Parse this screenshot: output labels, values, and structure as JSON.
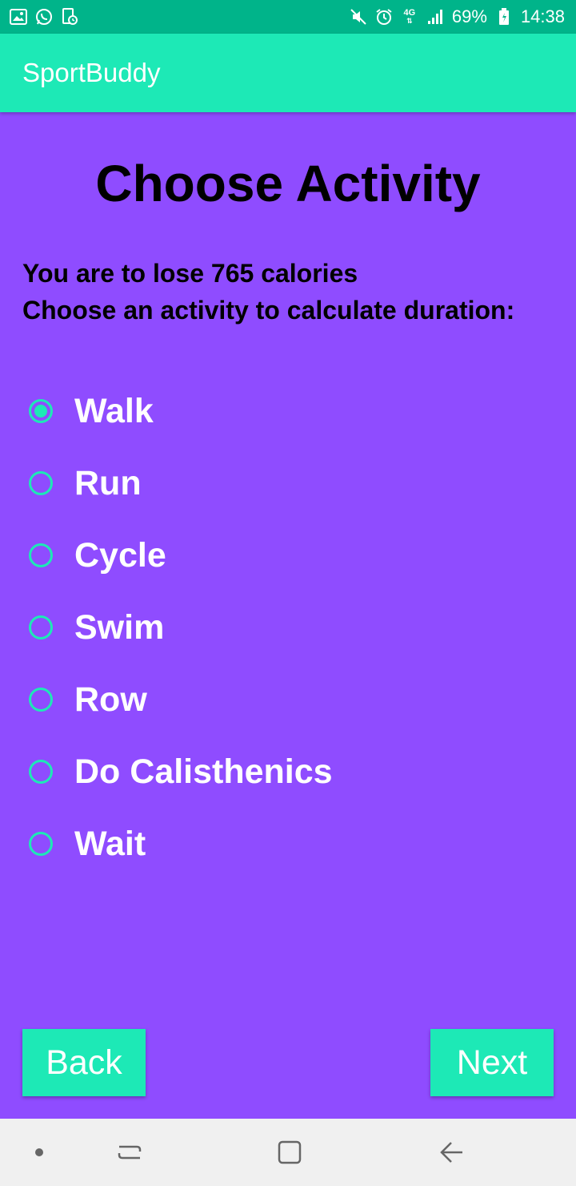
{
  "status_bar": {
    "battery": "69%",
    "time": "14:38",
    "network": "4G",
    "left_icons": [
      "gallery-icon",
      "whatsapp-icon",
      "screenshot-icon"
    ],
    "right_icons": [
      "mute-icon",
      "alarm-icon",
      "network-4g-icon",
      "signal-icon",
      "battery-icon"
    ]
  },
  "app_bar": {
    "title": "SportBuddy"
  },
  "main": {
    "title": "Choose Activity",
    "subtitle_line1": "You are to lose 765 calories",
    "subtitle_line2": "Choose an activity to calculate duration:",
    "activities": [
      {
        "label": "Walk",
        "selected": true
      },
      {
        "label": "Run",
        "selected": false
      },
      {
        "label": "Cycle",
        "selected": false
      },
      {
        "label": "Swim",
        "selected": false
      },
      {
        "label": "Row",
        "selected": false
      },
      {
        "label": "Do Calisthenics",
        "selected": false
      },
      {
        "label": "Wait",
        "selected": false
      }
    ]
  },
  "buttons": {
    "back": "Back",
    "next": "Next"
  },
  "nav_bar": {
    "icons": [
      "dot-icon",
      "recents-icon",
      "home-icon",
      "back-icon"
    ]
  },
  "colors": {
    "accent": "#1de9b6",
    "status_bar": "#00b48a",
    "background": "#8f4cff",
    "nav_bar": "#f0f0f0"
  }
}
